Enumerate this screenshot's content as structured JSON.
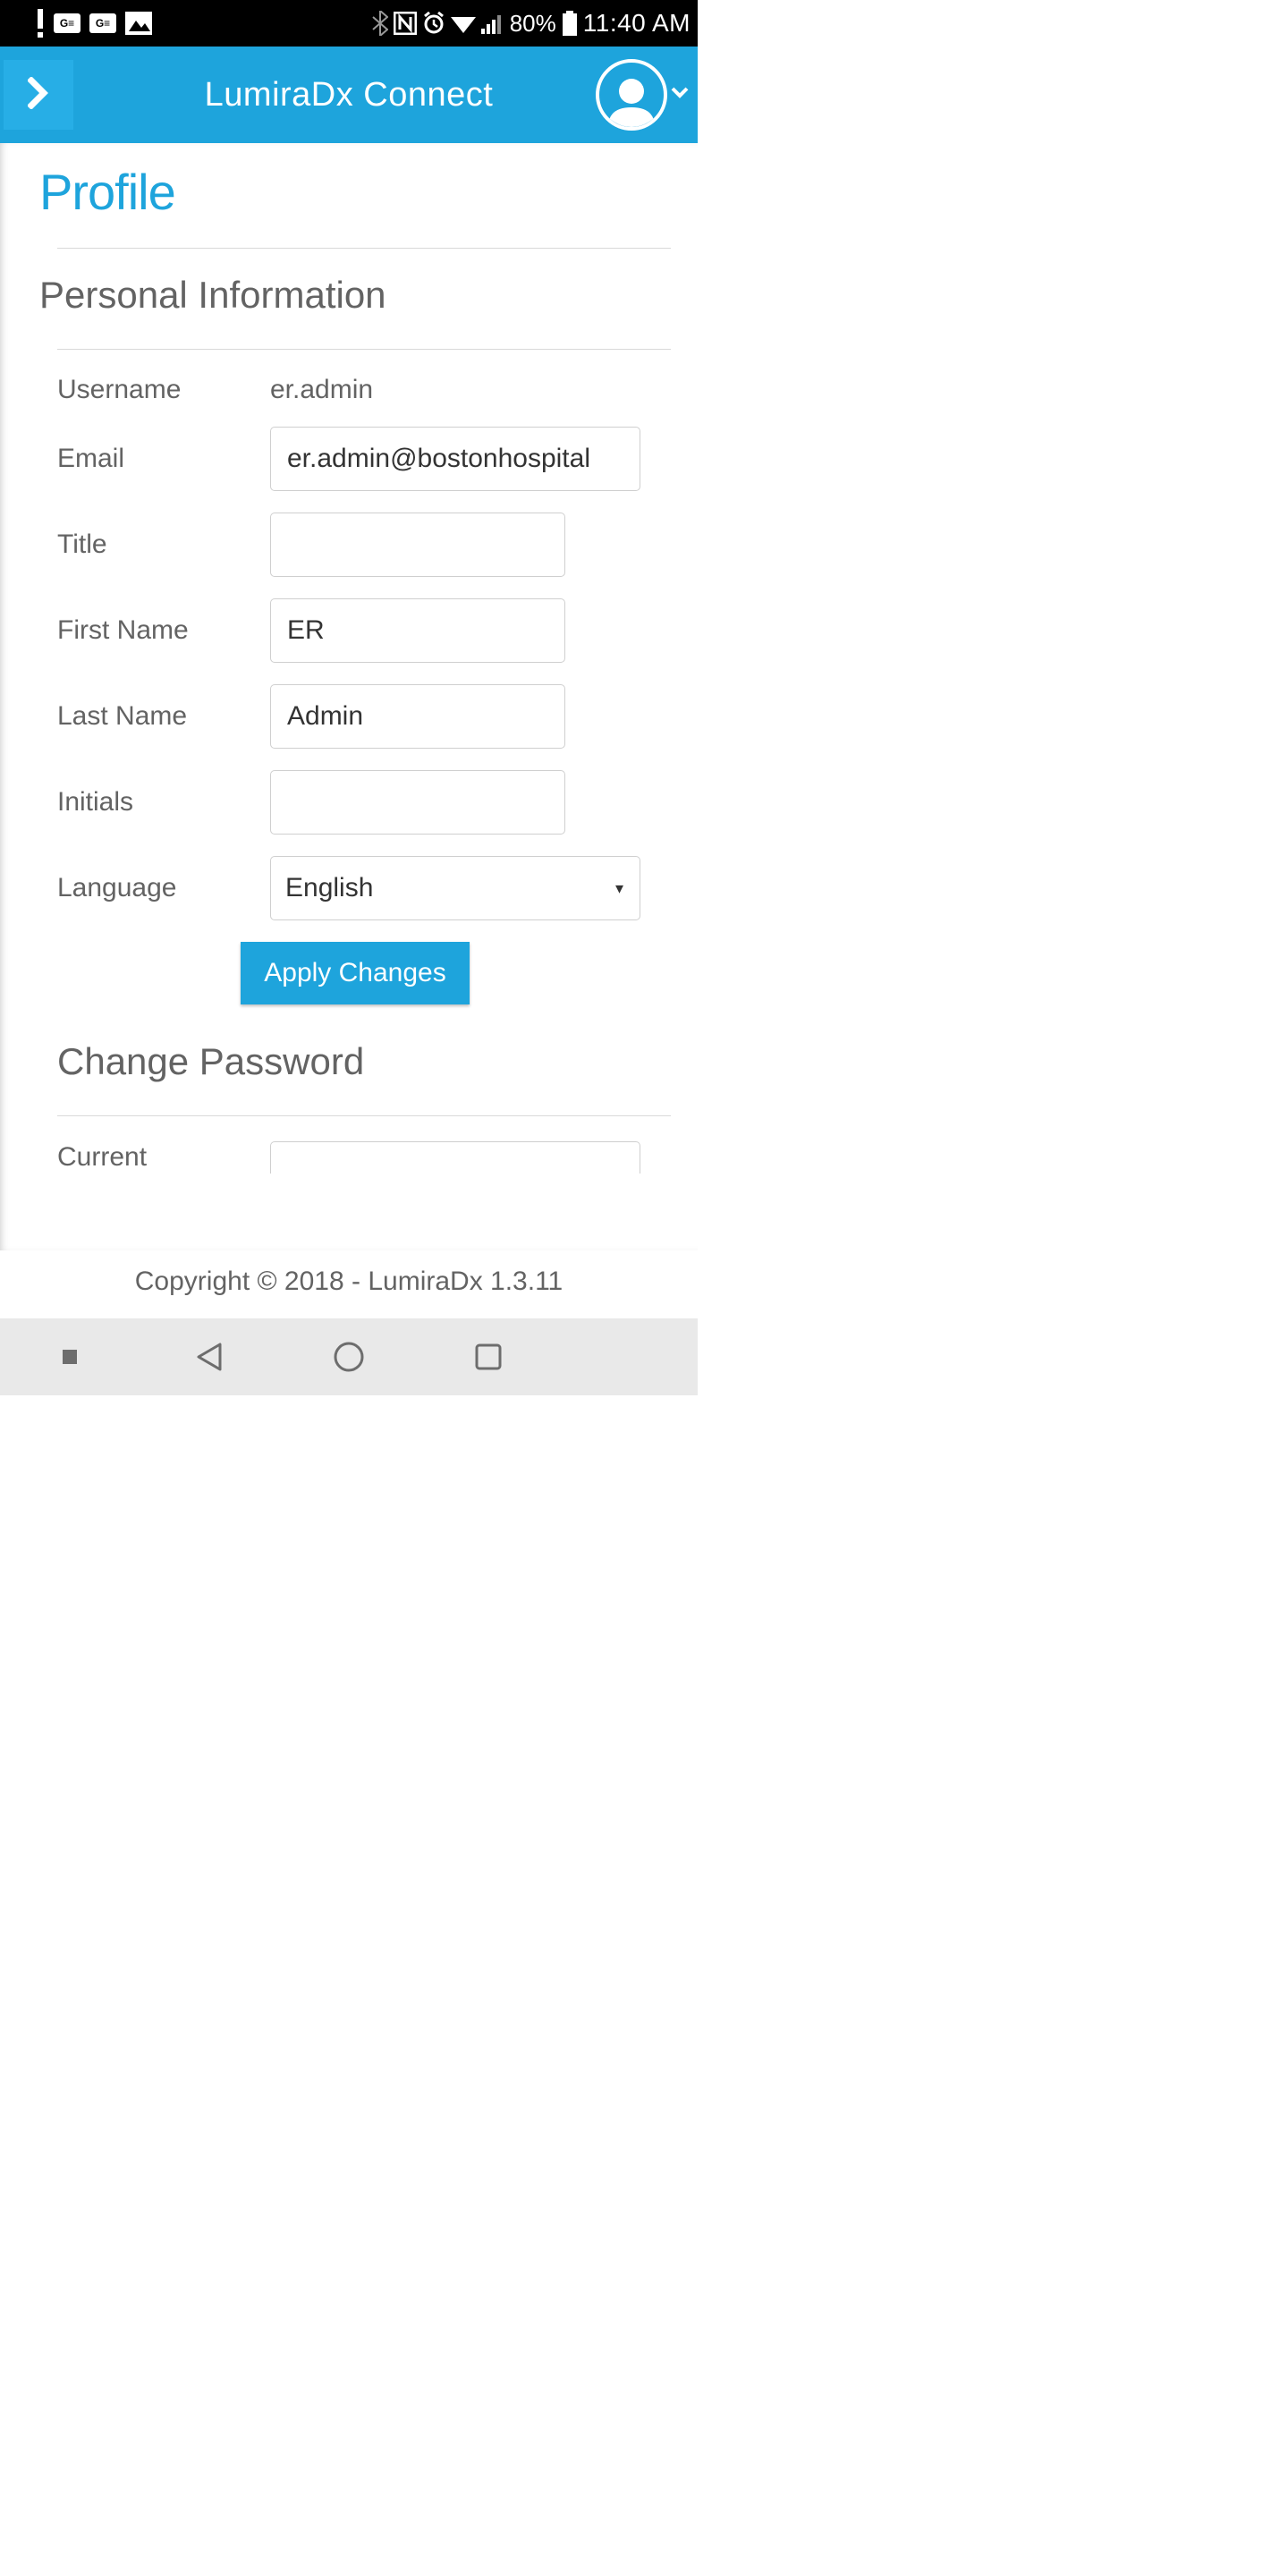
{
  "status": {
    "battery_pct": "80%",
    "time": "11:40 AM"
  },
  "header": {
    "title": "LumiraDx Connect"
  },
  "page": {
    "title": "Profile"
  },
  "personal": {
    "section_title": "Personal Information",
    "labels": {
      "username": "Username",
      "email": "Email",
      "title": "Title",
      "first_name": "First Name",
      "last_name": "Last Name",
      "initials": "Initials",
      "language": "Language"
    },
    "values": {
      "username": "er.admin",
      "email": "er.admin@bostonhospital",
      "title": "",
      "first_name": "ER",
      "last_name": "Admin",
      "initials": "",
      "language": "English"
    },
    "apply_label": "Apply Changes"
  },
  "password": {
    "section_title": "Change Password",
    "labels": {
      "current": "Current"
    },
    "values": {
      "current": ""
    }
  },
  "footer": {
    "copyright": "Copyright © 2018 - LumiraDx 1.3.11"
  }
}
